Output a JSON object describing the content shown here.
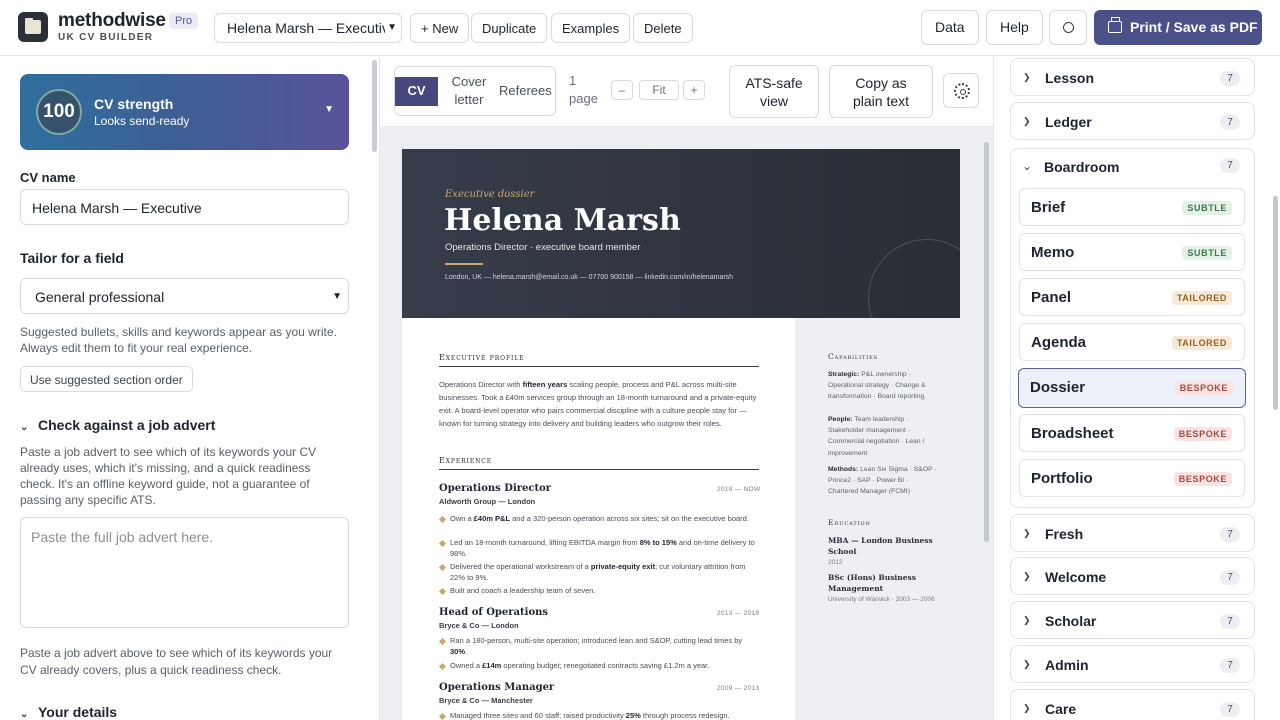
{
  "app": {
    "brand": "methodwise",
    "badge": "Pro",
    "subtitle": "UK CV BUILDER",
    "cv_select": "Helena Marsh — Executive",
    "actions": [
      "+ New",
      "Duplicate",
      "Examples",
      "Delete"
    ],
    "data_label": "Data",
    "help_label": "Help",
    "print_label": "Print / Save as PDF"
  },
  "left": {
    "strength_score": "100",
    "strength_title": "CV strength",
    "strength_status": "Looks send-ready",
    "cv_name_label": "CV name",
    "cv_name_value": "Helena Marsh — Executive",
    "tailor_heading": "Tailor for a field",
    "field_select": "General professional",
    "tailor_note": "Suggested bullets, skills and keywords appear as you write. Always edit them to fit your real experience.",
    "section_order_button": "Use suggested section order",
    "job_advert_heading": "Check against a job advert",
    "job_advert_note": "Paste a job advert to see which of its keywords your CV already uses, which it's missing, and a quick readiness check. It's an offline keyword guide, not a guarantee of passing any specific ATS.",
    "job_advert_placeholder": "Paste the full job advert here.",
    "job_advert_hint": "Paste a job advert above to see which of its keywords your CV already covers, plus a quick readiness check.",
    "details_heading": "Your details"
  },
  "center": {
    "tabs": [
      "CV",
      "Cover letter",
      "Referees"
    ],
    "page_count": "1 page",
    "zoom_out": "–",
    "zoom_fit": "Fit",
    "zoom_in": "+",
    "ats_button": "ATS-safe view",
    "copy_button": "Copy as plain text"
  },
  "cv": {
    "kicker": "Executive dossier",
    "name": "Helena Marsh",
    "title": "Operations Director · executive board member",
    "contact": "London, UK  —  helena.marsh@email.co.uk  —  07700 900158  —  linkedin.com/in/helenamarsh",
    "profile_heading": "Executive profile",
    "profile_text_1": "Operations Director with ",
    "profile_bold": "fifteen years",
    "profile_text_2": " scaling people, process and P&L across multi-site businesses. Took a £40m services group through an 18-month turnaround and a private-equity exit. A board-level operator who pairs commercial discipline with a culture people stay for — known for turning strategy into delivery and building leaders who outgrow their roles.",
    "experience_heading": "Experience",
    "jobs": [
      {
        "role": "Operations Director",
        "dates": "2018 — NOW",
        "company": "Aldworth Group — London",
        "bullets": [
          [
            "Own a ",
            "£40m P&L",
            " and a 320-person operation across six sites; sit on the executive board."
          ],
          [
            "Led an 18-month turnaround, lifting EBITDA margin from ",
            "8% to 15%",
            " and on-time delivery to 98%."
          ],
          [
            "Delivered the operational workstream of a ",
            "private-equity exit",
            "; cut voluntary attrition from 22% to 9%."
          ],
          [
            "Built and coach a leadership team of seven.",
            "",
            ""
          ]
        ]
      },
      {
        "role": "Head of Operations",
        "dates": "2013 — 2018",
        "company": "Bryce & Co — London",
        "bullets": [
          [
            "Ran a 180-person, multi-site operation; introduced lean and S&OP, cutting lead times by ",
            "30%",
            "."
          ],
          [
            "Owned a ",
            "£14m",
            " operating budget; renegotiated contracts saving £1.2m a year."
          ]
        ]
      },
      {
        "role": "Operations Manager",
        "dates": "2009 — 2013",
        "company": "Bryce & Co — Manchester",
        "bullets": [
          [
            "Managed three sites and 60 staff; raised productivity ",
            "25%",
            " through process redesign."
          ]
        ]
      }
    ],
    "capabilities_heading": "Capabilities",
    "capabilities": [
      {
        "label": "Strategic:",
        "text": " P&L ownership · Operational strategy · Change & transformation · Board reporting"
      },
      {
        "label": "People:",
        "text": " Team leadership · Stakeholder management · Commercial negotiation · Lean / improvement"
      },
      {
        "label": "Methods:",
        "text": " Lean Six Sigma · S&OP · Prince2 · SAP · Power BI · Chartered Manager (FCMI)"
      }
    ],
    "education_heading": "Education",
    "education": [
      {
        "degree": "MBA — London Business School",
        "detail": "2012"
      },
      {
        "degree": "BSc (Hons) Business Management",
        "detail": "University of Warwick · 2003 — 2006"
      }
    ]
  },
  "right": {
    "groups_top": [
      {
        "name": "Lesson",
        "count": "7"
      },
      {
        "name": "Ledger",
        "count": "7"
      }
    ],
    "open_group": {
      "name": "Boardroom",
      "count": "7"
    },
    "templates": [
      {
        "name": "Brief",
        "badge": "SUBTLE"
      },
      {
        "name": "Memo",
        "badge": "SUBTLE"
      },
      {
        "name": "Panel",
        "badge": "TAILORED"
      },
      {
        "name": "Agenda",
        "badge": "TAILORED"
      },
      {
        "name": "Dossier",
        "badge": "BESPOKE"
      },
      {
        "name": "Broadsheet",
        "badge": "BESPOKE"
      },
      {
        "name": "Portfolio",
        "badge": "BESPOKE"
      }
    ],
    "groups_bottom": [
      {
        "name": "Fresh",
        "count": "7"
      },
      {
        "name": "Welcome",
        "count": "7"
      },
      {
        "name": "Scholar",
        "count": "7"
      },
      {
        "name": "Admin",
        "count": "7"
      },
      {
        "name": "Care",
        "count": "7"
      }
    ]
  }
}
